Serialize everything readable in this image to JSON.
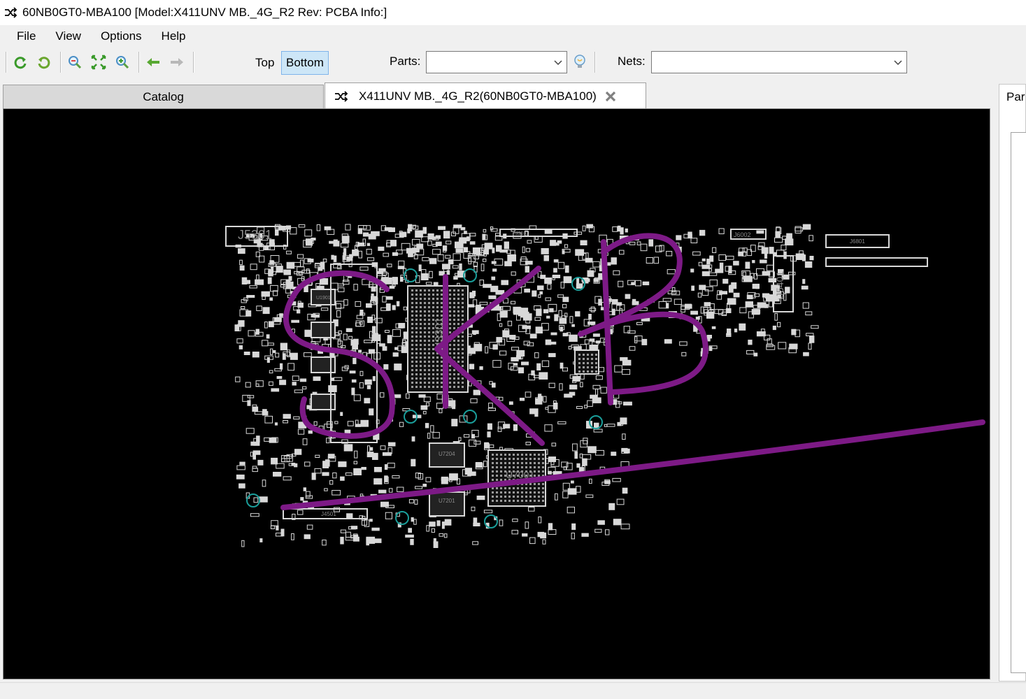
{
  "window": {
    "title": "60NB0GT0-MBA100 [Model:X411UNV MB._4G_R2 Rev: PCBA Info:]",
    "icon": "shuffle-icon"
  },
  "menu": [
    "File",
    "View",
    "Options",
    "Help"
  ],
  "toolbar": {
    "buttons": [
      "refresh-icon",
      "rotate-icon",
      "zoom-out-icon",
      "fit-icon",
      "zoom-in-icon",
      "back-arrow-icon",
      "forward-arrow-icon"
    ],
    "side_top": "Top",
    "side_bottom": "Bottom",
    "active_side": "Bottom",
    "parts_label": "Parts:",
    "parts_value": "",
    "nets_label": "Nets:",
    "nets_value": "",
    "search_icon": "lightbulb-icon"
  },
  "tabs": {
    "catalog": "Catalog",
    "board": "X411UNV MB._4G_R2(60NB0GT0-MBA100)"
  },
  "board": {
    "ref_labels": [
      "J5301",
      "J3101",
      "J6002",
      "J6801",
      "J5401",
      "U3301",
      "U1901",
      "U7204",
      "U7201",
      "U7001",
      "J4501"
    ],
    "annotation_text": "SKB",
    "annotation_color": "#7d1a86",
    "trace_color": "#d8d8d8",
    "via_color": "#1a9e9a"
  },
  "right_panel": {
    "tab_label": "Par"
  }
}
